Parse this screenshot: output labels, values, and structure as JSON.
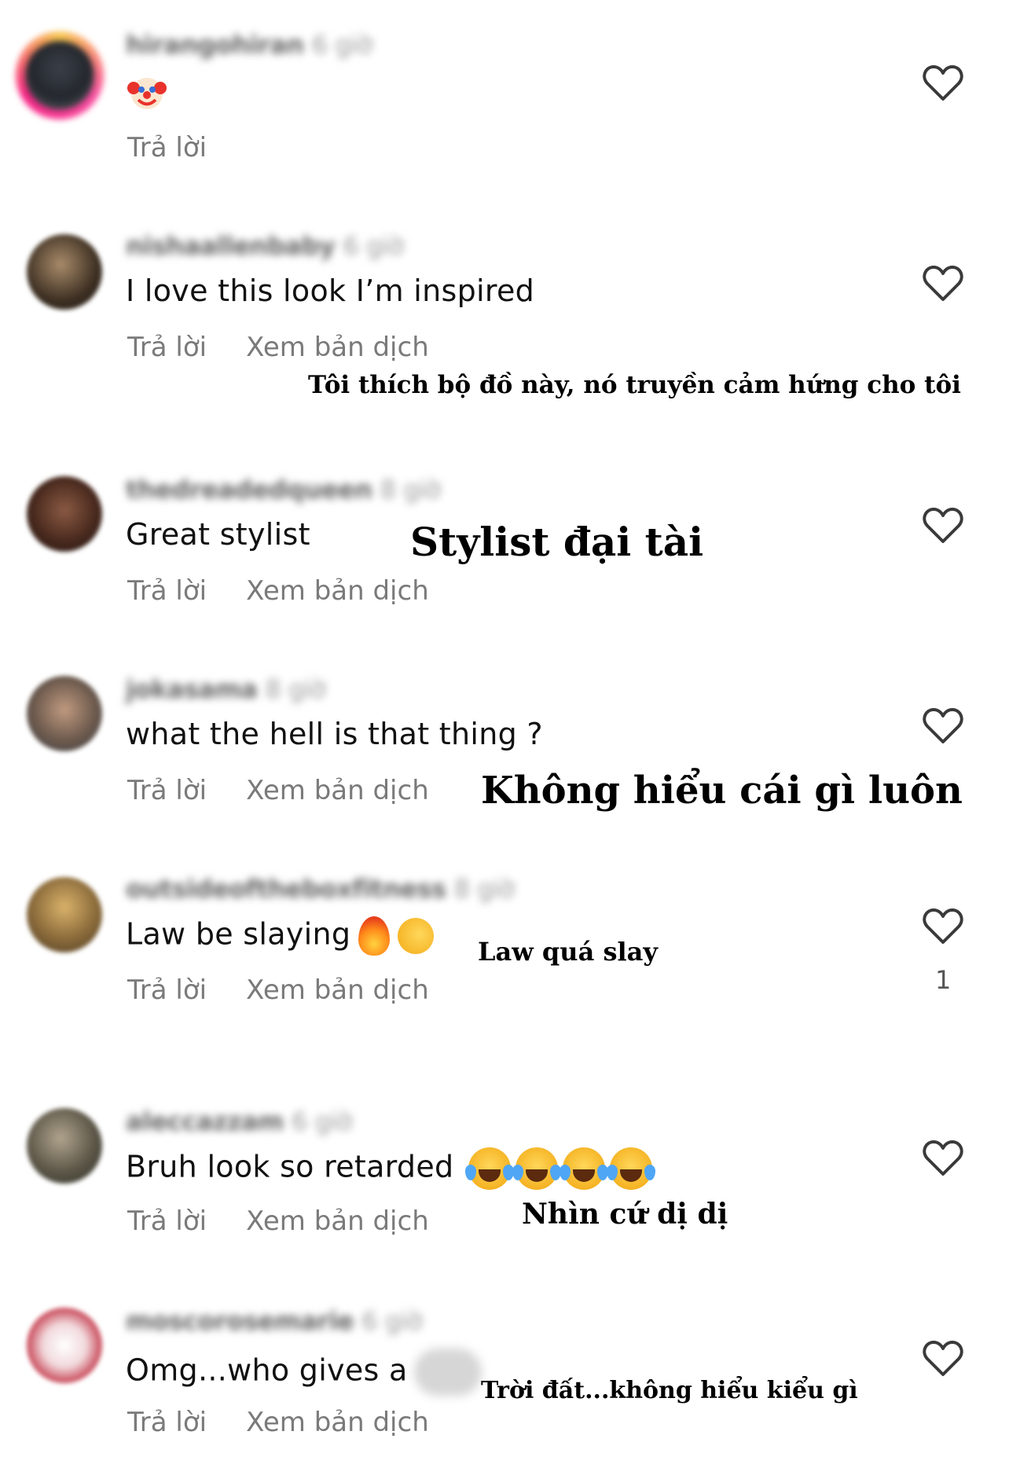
{
  "comments": [
    {
      "username": "hirangohiran",
      "time": "6 giờ",
      "text": "",
      "emoji": "clown-face",
      "reply_label": "Trả lời",
      "translate_label": "",
      "translation_overlay": "",
      "like_count": ""
    },
    {
      "username": "nishaallenbaby",
      "time": "6 giờ",
      "text": "I love this look I’m inspired",
      "reply_label": "Trả lời",
      "translate_label": "Xem bản dịch",
      "translation_overlay": "Tôi thích bộ đồ này, nó truyền cảm hứng cho tôi",
      "like_count": ""
    },
    {
      "username": "thedreadedqueen",
      "time": "8 giờ",
      "text": "Great stylist",
      "reply_label": "Trả lời",
      "translate_label": "Xem bản dịch",
      "translation_overlay": "Stylist đại tài",
      "like_count": ""
    },
    {
      "username": "jokasama",
      "time": "8 giờ",
      "text": "what the hell is that thing ?",
      "reply_label": "Trả lời",
      "translate_label": "Xem bản dịch",
      "translation_overlay": "Không hiểu cái gì luôn",
      "like_count": ""
    },
    {
      "username": "outsideoftheboxfitness",
      "time": "8 giờ",
      "text": "Law be slaying",
      "emoji": [
        "fire",
        "backhand-index-pointing-left"
      ],
      "reply_label": "Trả lời",
      "translate_label": "Xem bản dịch",
      "translation_overlay": "Law quá slay",
      "like_count": "1"
    },
    {
      "username": "aleccazzam",
      "time": "6 giờ",
      "text": "Bruh look so retarded",
      "emoji": [
        "face-with-tears-of-joy",
        "face-with-tears-of-joy",
        "face-with-tears-of-joy",
        "face-with-tears-of-joy"
      ],
      "reply_label": "Trả lời",
      "translate_label": "Xem bản dịch",
      "translation_overlay": "Nhìn cứ dị dị",
      "like_count": ""
    },
    {
      "username": "moscorosemarie",
      "time": "6 giờ",
      "text": "Omg...who gives a",
      "reply_label": "Trả lời",
      "translate_label": "Xem bản dịch",
      "translation_overlay": "Trời đất...không hiểu kiểu gì",
      "like_count": ""
    }
  ],
  "colors": {
    "text": "#111111",
    "secondary": "#7a7a7a",
    "heart_stroke": "#3a3a3a"
  },
  "icons": {
    "like": "heart-outline-icon"
  }
}
